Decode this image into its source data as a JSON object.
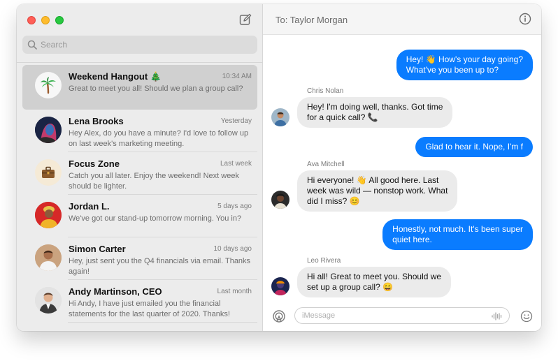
{
  "sidebar": {
    "search_placeholder": "Search",
    "conversations": [
      {
        "name": "Weekend Hangout 🎄",
        "time": "10:34 AM",
        "preview": "Great to meet you all! Should we plan a group call?",
        "avatar_icon": "palm-tree-icon"
      },
      {
        "name": "Lena Brooks",
        "time": "Yesterday",
        "preview": "Hey Alex, do you have a minute? I'd love to follow up on last week's marketing meeting.",
        "avatar_icon": "person-avatar"
      },
      {
        "name": "Focus Zone",
        "time": "Last week",
        "preview": "Catch you all later. Enjoy the weekend! Next week should be lighter.",
        "avatar_icon": "briefcase-icon"
      },
      {
        "name": "Jordan L.",
        "time": "5 days ago",
        "preview": "We've got our stand-up tomorrow morning. You in?",
        "avatar_icon": "person-avatar"
      },
      {
        "name": "Simon Carter",
        "time": "10 days ago",
        "preview": "Hey, just sent you the Q4 financials via email. Thanks again!",
        "avatar_icon": "person-avatar"
      },
      {
        "name": "Andy Martinson, CEO",
        "time": "Last month",
        "preview": "Hi Andy, I have just emailed you the financial statements for the last quarter of 2020. Thanks!",
        "avatar_icon": "person-avatar"
      }
    ]
  },
  "chat": {
    "to_label": "To: Taylor Morgan",
    "messages": [
      {
        "direction": "out",
        "lines": [
          "Hey! 👋 How's your day going?",
          "What've you been up to?"
        ]
      },
      {
        "direction": "in",
        "sender": "Chris Nolan",
        "lines": [
          "Hey! I'm doing well, thanks. Got time",
          "for a quick call? 📞"
        ]
      },
      {
        "direction": "out",
        "lines": [
          "Glad to hear it. Nope, I'm f"
        ]
      },
      {
        "direction": "in",
        "sender": "Ava Mitchell",
        "lines": [
          "Hi everyone! 👋 All good here. Last",
          "week was wild — nonstop work. What",
          "did I miss? 😊"
        ]
      },
      {
        "direction": "out",
        "lines": [
          "Honestly, not much. It's been super",
          "quiet here."
        ]
      },
      {
        "direction": "in",
        "sender": "Leo Rivera",
        "lines": [
          "Hi all! Great to meet you. Should we",
          "set up a group call? 😄"
        ]
      }
    ],
    "composer_placeholder": "iMessage"
  },
  "colors": {
    "accent_blue": "#0a7cff",
    "incoming_gray": "#ebebeb",
    "sidebar_bg": "#ececec",
    "selected_row": "#d0d0d0"
  }
}
